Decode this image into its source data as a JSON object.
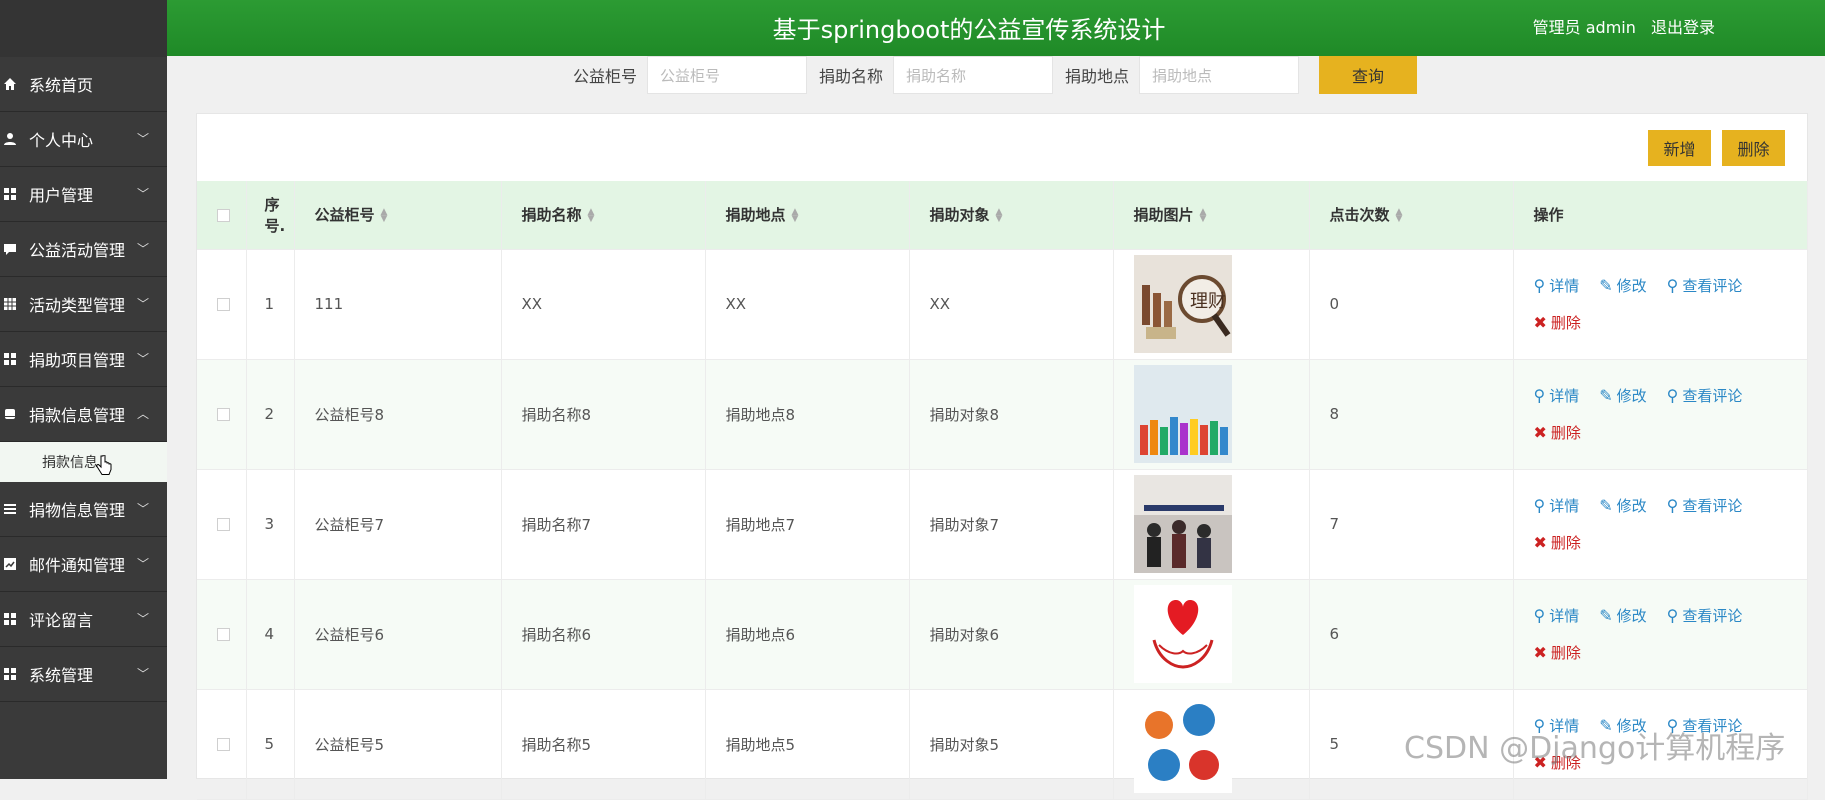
{
  "header": {
    "title": "基于springboot的公益宣传系统设计",
    "user": "管理员 admin",
    "logout": "退出登录"
  },
  "sidebar": {
    "items": [
      {
        "label": "系统首页",
        "icon": "home-icon",
        "expandable": false
      },
      {
        "label": "个人中心",
        "icon": "user-icon",
        "expandable": true
      },
      {
        "label": "用户管理",
        "icon": "grid-icon",
        "expandable": true
      },
      {
        "label": "公益活动管理",
        "icon": "comment-icon",
        "expandable": true
      },
      {
        "label": "活动类型管理",
        "icon": "table-icon",
        "expandable": true
      },
      {
        "label": "捐助项目管理",
        "icon": "grid-icon",
        "expandable": true
      },
      {
        "label": "捐款信息管理",
        "icon": "tablet-icon",
        "expandable": true,
        "expanded": true
      },
      {
        "label": "捐物信息管理",
        "icon": "list-icon",
        "expandable": true
      },
      {
        "label": "邮件通知管理",
        "icon": "chart-icon",
        "expandable": true
      },
      {
        "label": "评论留言",
        "icon": "grid-icon",
        "expandable": true
      },
      {
        "label": "系统管理",
        "icon": "grid-icon",
        "expandable": true
      }
    ],
    "subitem": "捐款信息"
  },
  "search": {
    "fields": [
      {
        "label": "公益柜号",
        "placeholder": "公益柜号"
      },
      {
        "label": "捐助名称",
        "placeholder": "捐助名称"
      },
      {
        "label": "捐助地点",
        "placeholder": "捐助地点"
      }
    ],
    "button": "查询"
  },
  "actions": {
    "add": "新增",
    "delete": "删除"
  },
  "table": {
    "headers": [
      "序号.",
      "公益柜号",
      "捐助名称",
      "捐助地点",
      "捐助对象",
      "捐助图片",
      "点击次数",
      "操作"
    ],
    "rows": [
      {
        "idx": "1",
        "cabinet": "111",
        "name": "XX",
        "place": "XX",
        "target": "XX",
        "img": "finance",
        "clicks": "0"
      },
      {
        "idx": "2",
        "cabinet": "公益柜号8",
        "name": "捐助名称8",
        "place": "捐助地点8",
        "target": "捐助对象8",
        "img": "hands",
        "clicks": "8"
      },
      {
        "idx": "3",
        "cabinet": "公益柜号7",
        "name": "捐助名称7",
        "place": "捐助地点7",
        "target": "捐助对象7",
        "img": "crowd",
        "clicks": "7"
      },
      {
        "idx": "4",
        "cabinet": "公益柜号6",
        "name": "捐助名称6",
        "place": "捐助地点6",
        "target": "捐助对象6",
        "img": "heart",
        "clicks": "6"
      },
      {
        "idx": "5",
        "cabinet": "公益柜号5",
        "name": "捐助名称5",
        "place": "捐助地点5",
        "target": "捐助对象5",
        "img": "charity",
        "clicks": "5"
      }
    ],
    "ops": {
      "detail": "详情",
      "edit": "修改",
      "comments": "查看评论",
      "delete": "删除"
    }
  },
  "watermark": "CSDN @Django计算机程序",
  "colors": {
    "header": "#1f8a27",
    "sidebar": "#3a3a3a",
    "accent": "#e6b21f",
    "thead": "#e3f5e4"
  }
}
